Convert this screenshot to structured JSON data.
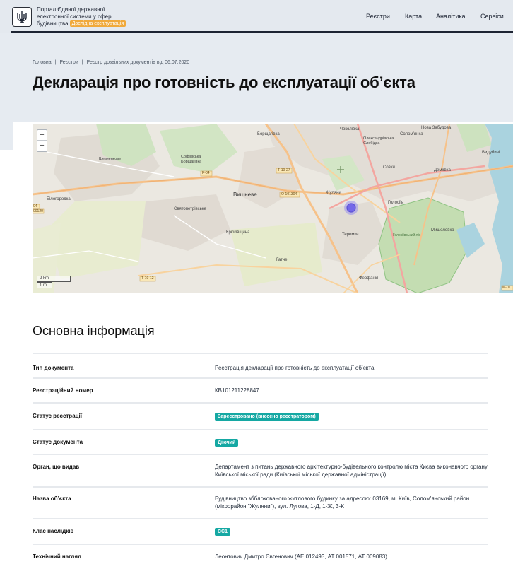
{
  "header": {
    "brand_line1": "Портал Єдиної державної",
    "brand_line2": "електронної системи у сфері",
    "brand_line3": "будівництва",
    "beta_badge": "Дослідна експлуатація",
    "nav": [
      "Реєстри",
      "Карта",
      "Аналітика",
      "Сервіси"
    ]
  },
  "breadcrumbs": [
    "Головна",
    "Реєстри",
    "Реєстр дозвільних документів від 06.07.2020"
  ],
  "page_title": "Декларація про готовність до експлуатації об’єкта",
  "map": {
    "zoom_in": "+",
    "zoom_out": "−",
    "scale_km": "2 km",
    "scale_mi": "1 mi",
    "labels": {
      "borshchahivka": "Борщагівка",
      "sofiivska": "Софіївська Борщагівка",
      "chokolivka": "Чоколівка",
      "oleksandrivska": "Олександрівська Слобідка",
      "solomianka": "Соломʼянка",
      "nova_zabudova": "Нова Забудова",
      "sovky": "Совки",
      "demiivka": "Деміївка",
      "zhuliany": "Жуляни",
      "holosiiv": "Голосіїв",
      "vyshneve": "Вишневе",
      "sviatopetrivske": "Святопетрівське",
      "bilohorodka": "Білогородка",
      "shevchenkove": "Шевченкове",
      "kriukivshchyna": "Крюківщина",
      "teremky": "Теремки",
      "mytsolovka": "Мишоловка",
      "holosiivskyi_lis": "Голосіївський ліс",
      "hatne": "Гатне",
      "feofaniia": "Феофанія",
      "vydubychi": "Видубичі",
      "r_p04": "Р-04",
      "t_1027": "Т-10-27",
      "o_101304": "О-101304",
      "t_1012": "Т-10-12",
      "r_04": "04",
      "r_0120": "00120",
      "m_01": "М-01"
    }
  },
  "section_title": "Основна інформація",
  "info_rows": [
    {
      "label": "Тип документа",
      "value": "Реєстрація декларації про готовність до експлуатації об’єкта"
    },
    {
      "label": "Реєстраційний номер",
      "value": "КВ101211228847"
    },
    {
      "label": "Статус реєстрації",
      "value": "Зареєстровано (внесено реєстратором)"
    },
    {
      "label": "Статус документа",
      "value": "Діючий"
    },
    {
      "label": "Орган, що видав",
      "value": "Департамент з питань державного архітектурно-будівельного контролю міста Києва виконавчого органу Київської міської ради (Київської міської державної адміністрації)"
    },
    {
      "label": "Назва об’єкта",
      "value": "Будівництво збблокованого житлового будинку за адресою: 03169, м. Київ, Солом'янський район (мікрорайон \"Жуляни\"), вул. Лугова, 1-Д, 1-Ж, 3-К"
    },
    {
      "label": "Клас наслідків",
      "value": "СС1"
    },
    {
      "label": "Технічний нагляд",
      "value": "Леонтович Дмитро Євгенович (АЕ 012493, АТ 001571, АТ 009083)"
    }
  ],
  "colors": {
    "accent_teal": "#15a8a3",
    "beta_orange": "#f0a93b",
    "hero_bg": "#e6ebf1"
  }
}
